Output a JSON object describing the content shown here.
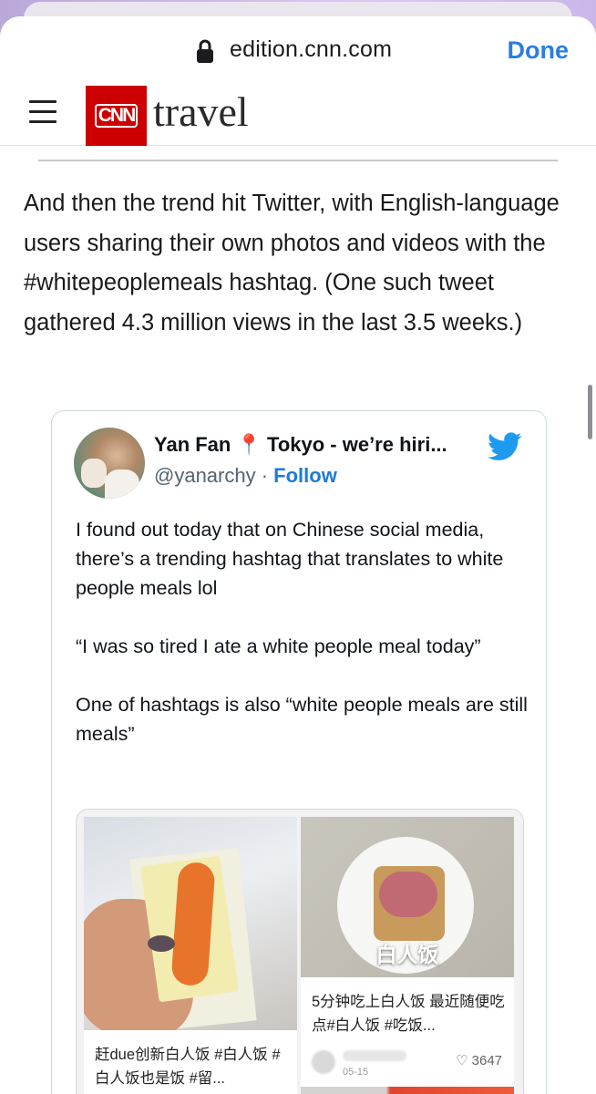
{
  "browser": {
    "url": "edition.cnn.com",
    "done_label": "Done"
  },
  "site": {
    "logo_text": "CNN",
    "section": "travel"
  },
  "article": {
    "paragraph": "And then the trend hit Twitter, with English-language users sharing their own photos and videos with the #whitepeoplemeals hashtag. (One such tweet gathered 4.3 million views in the last 3.5 weeks.)"
  },
  "tweet": {
    "author_name": "Yan Fan",
    "author_location": "Tokyo - we’re hiri...",
    "handle": "@yanarchy",
    "separator": " · ",
    "follow_label": "Follow",
    "text": "I found out today that on Chinese social media, there’s a trending hashtag that translates to white people meals lol\n\n“I was so tired I ate a white people meal today”\n\nOne of hashtags is also “white people meals are still meals”",
    "media": {
      "card1_caption": "赶due创新白人饭 #白人饭 #白人饭也是饭 #留...",
      "card2_overlay": "白人饭",
      "card2_caption": "5分钟吃上白人饭 最近随便吃点#白人饭 #吃饭...",
      "card2_date": "05-15",
      "card2_likes": "♡ 3647"
    }
  },
  "icons": [
    "lock-icon",
    "hamburger-menu-icon",
    "twitter-bird-icon",
    "location-pin-icon",
    "heart-icon"
  ],
  "colors": {
    "done_blue": "#2b7de1",
    "cnn_red": "#cc0000",
    "twitter_blue": "#1d9bf0",
    "follow_blue": "#1d7bd7"
  }
}
